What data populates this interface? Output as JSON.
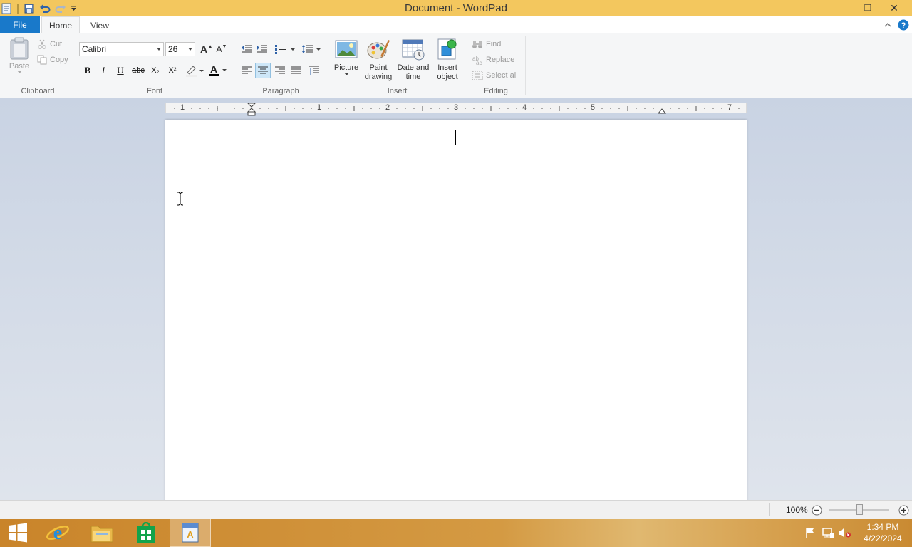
{
  "window": {
    "title": "Document - WordPad",
    "minimize": "–",
    "restore": "❐",
    "close": "✕"
  },
  "tabs": {
    "file": "File",
    "home": "Home",
    "view": "View"
  },
  "ribbon": {
    "clipboard": {
      "label": "Clipboard",
      "paste": "Paste",
      "cut": "Cut",
      "copy": "Copy"
    },
    "font": {
      "label": "Font",
      "family": "Calibri",
      "size": "26",
      "bold": "B",
      "italic": "I",
      "underline": "U",
      "strike": "abc",
      "subscript": "X₂",
      "superscript": "X²",
      "text_color_letter": "A",
      "grow_letter": "A",
      "shrink_letter": "A"
    },
    "paragraph": {
      "label": "Paragraph"
    },
    "insert": {
      "label": "Insert",
      "picture": "Picture",
      "paint_line1": "Paint",
      "paint_line2": "drawing",
      "date_line1": "Date and",
      "date_line2": "time",
      "object_line1": "Insert",
      "object_line2": "object"
    },
    "editing": {
      "label": "Editing",
      "find": "Find",
      "replace": "Replace",
      "select_all": "Select all"
    }
  },
  "ruler": {
    "numbers": [
      "1",
      "1",
      "2",
      "3",
      "4",
      "5",
      "7"
    ]
  },
  "status": {
    "zoom": "100%"
  },
  "taskbar": {
    "time": "1:34 PM",
    "date": "4/22/2024"
  },
  "colors": {
    "titlebar": "#f3c75e",
    "file_tab": "#1979ca",
    "taskbar": "#d49a43",
    "workspace": "#cfd8e6"
  }
}
